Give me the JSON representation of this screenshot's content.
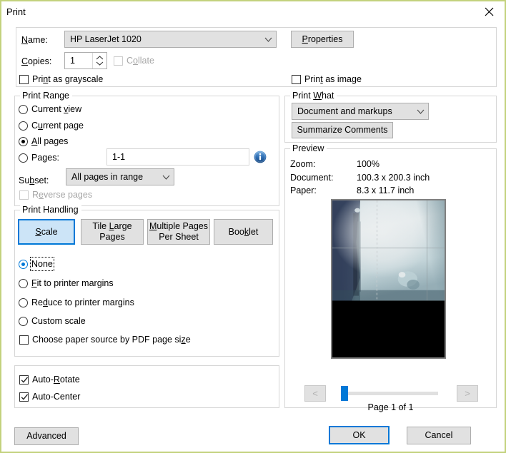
{
  "window": {
    "title": "Print",
    "close_icon": "close-icon",
    "border_color": "#c3d27d"
  },
  "printer": {
    "name_label": "Name:",
    "name_value": "HP LaserJet 1020",
    "properties_button": "Properties",
    "copies_label": "Copies:",
    "copies_value": "1",
    "collate_label": "Collate",
    "collate_checked": false,
    "collate_enabled": false,
    "print_as_grayscale_label": "Print as grayscale",
    "print_as_grayscale_checked": false,
    "print_as_image_label": "Print as image",
    "print_as_image_checked": false
  },
  "print_range": {
    "group_title": "Print Range",
    "options": [
      {
        "label": "Current view",
        "selected": false
      },
      {
        "label": "Current page",
        "selected": false
      },
      {
        "label": "All pages",
        "selected": true
      },
      {
        "label": "Pages:",
        "selected": false
      }
    ],
    "pages_value": "1-1",
    "info_icon": "info-icon",
    "subset_label": "Subset:",
    "subset_value": "All pages in range",
    "reverse_pages_label": "Reverse pages",
    "reverse_pages_checked": false,
    "reverse_pages_enabled": false
  },
  "print_handling": {
    "group_title": "Print Handling",
    "tabs": [
      {
        "label": "Scale",
        "selected": true
      },
      {
        "label": "Tile Large Pages",
        "line1": "Tile Large",
        "line2": "Pages",
        "selected": false
      },
      {
        "label": "Multiple Pages Per Sheet",
        "line1": "Multiple Pages",
        "line2": "Per Sheet",
        "selected": false
      },
      {
        "label": "Booklet",
        "selected": false
      }
    ],
    "scale_options": [
      {
        "label": "None",
        "selected": true,
        "focused": true
      },
      {
        "label": "Fit to printer margins",
        "selected": false,
        "focused": false
      },
      {
        "label": "Reduce to printer margins",
        "selected": false,
        "focused": false
      },
      {
        "label": "Custom scale",
        "selected": false,
        "focused": false
      }
    ],
    "paper_source_label": "Choose paper source by PDF page size",
    "paper_source_checked": false
  },
  "auto_options": {
    "auto_rotate_label": "Auto-Rotate",
    "auto_rotate_checked": true,
    "auto_center_label": "Auto-Center",
    "auto_center_checked": true
  },
  "print_what": {
    "group_title": "Print What",
    "value": "Document and markups",
    "summarize_button": "Summarize Comments"
  },
  "preview": {
    "group_title": "Preview",
    "zoom_label": "Zoom:",
    "zoom_value": "100%",
    "document_label": "Document:",
    "document_value": "100.3 x 200.3 inch",
    "paper_label": "Paper:",
    "paper_value": "8.3 x 11.7 inch",
    "prev_button": "<",
    "next_button": ">",
    "page_indicator": "Page 1 of 1"
  },
  "footer": {
    "advanced_button": "Advanced",
    "ok_button": "OK",
    "cancel_button": "Cancel"
  }
}
